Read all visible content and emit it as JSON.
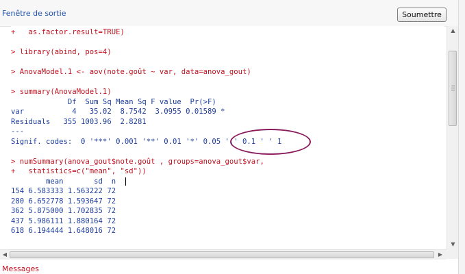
{
  "header": {
    "title": "Fenêtre de sortie",
    "submit_label": "Soumettre"
  },
  "output": {
    "lines": [
      {
        "kind": "cmd",
        "text": "+   as.factor.result=TRUE)"
      },
      {
        "kind": "blank",
        "text": ""
      },
      {
        "kind": "cmd",
        "text": "> library(abind, pos=4)"
      },
      {
        "kind": "blank",
        "text": ""
      },
      {
        "kind": "cmd",
        "text": "> AnovaModel.1 <- aov(note.goût ~ var, data=anova_gout)"
      },
      {
        "kind": "blank",
        "text": ""
      },
      {
        "kind": "cmd",
        "text": "> summary(AnovaModel.1)"
      },
      {
        "kind": "out",
        "text": "             Df  Sum Sq Mean Sq F value  Pr(>F)"
      },
      {
        "kind": "out",
        "text": "var           4   35.02  8.7542  3.0955 0.01589 *"
      },
      {
        "kind": "out",
        "text": "Residuals   355 1003.96  2.8281"
      },
      {
        "kind": "out",
        "text": "---"
      },
      {
        "kind": "out",
        "text": "Signif. codes:  0 '***' 0.001 '**' 0.01 '*' 0.05 '.' 0.1 ' ' 1"
      },
      {
        "kind": "blank",
        "text": ""
      },
      {
        "kind": "cmd",
        "text": "> numSummary(anova_gout$note.goût , groups=anova_gout$var,"
      },
      {
        "kind": "cmd",
        "text": "+   statistics=c(\"mean\", \"sd\"))"
      },
      {
        "kind": "out",
        "text": "        mean       sd  n"
      },
      {
        "kind": "out",
        "text": "154 6.583333 1.563222 72"
      },
      {
        "kind": "out",
        "text": "280 6.652778 1.593647 72"
      },
      {
        "kind": "out",
        "text": "362 5.875000 1.702835 72"
      },
      {
        "kind": "out",
        "text": "437 5.986111 1.880164 72"
      },
      {
        "kind": "out",
        "text": "618 6.194444 1.648016 72"
      }
    ]
  },
  "scrollbar": {
    "up_icon": "arrow-up-icon",
    "down_icon": "arrow-down-icon",
    "left_icon": "arrow-left-icon",
    "right_icon": "arrow-right-icon"
  },
  "footer": {
    "messages_label": "Messages"
  },
  "colors": {
    "command": "#c1121f",
    "output": "#1f3f9e",
    "header_title": "#1d4fa8",
    "annotation": "#8a1b5c"
  }
}
